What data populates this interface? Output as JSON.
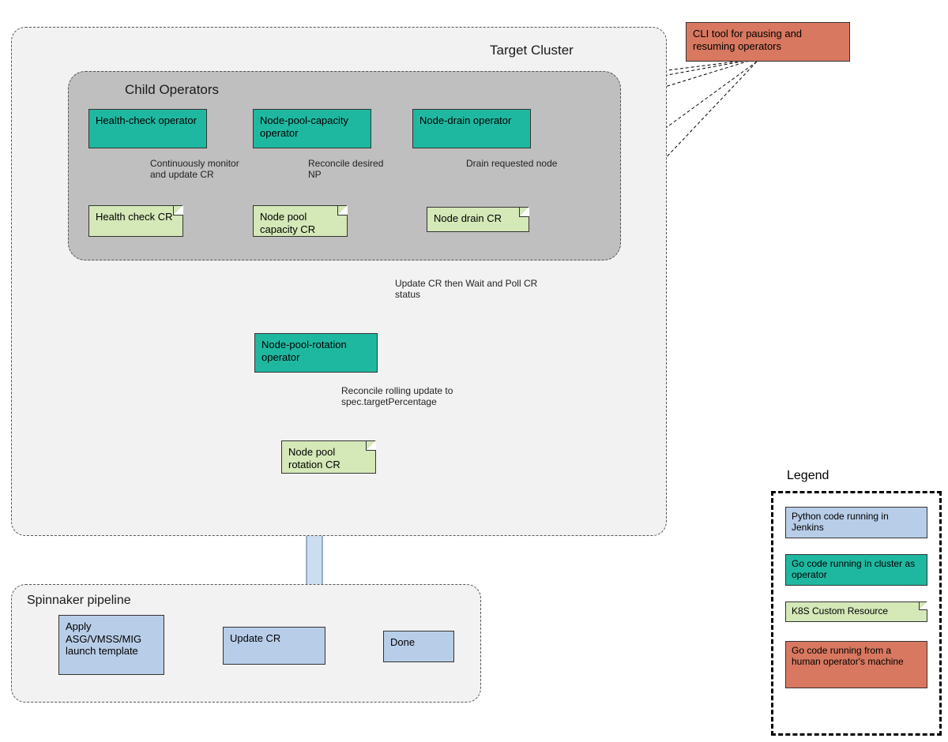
{
  "targetCluster": {
    "title": "Target Cluster",
    "childOperators": {
      "title": "Child Operators",
      "healthCheckOp": "Health-check operator",
      "nodePoolCapOp": "Node-pool-capacity operator",
      "nodeDrainOp": "Node-drain operator",
      "healthCheckCR": "Health check CR",
      "nodePoolCapCR": "Node pool capacity CR",
      "nodeDrainCR": "Node drain CR",
      "labelMonitor": "Continuously monitor and update CR",
      "labelReconcileNP": "Reconcile desired NP",
      "labelDrainNode": "Drain requested node"
    },
    "rotationOp": "Node-pool-rotation operator",
    "rotationCR": "Node pool rotation CR",
    "labelUpdatePoll": "Update CR then Wait and Poll CR status",
    "labelReconcileRolling": "Reconcile rolling update to spec.targetPercentage"
  },
  "spinnaker": {
    "title": "Spinnaker pipeline",
    "step1": "Apply ASG/VMSS/MIG launch template",
    "step2": "Update CR",
    "step3": "Done"
  },
  "cliTool": "CLI tool for pausing and resuming operators",
  "legend": {
    "title": "Legend",
    "python": "Python code running in Jenkins",
    "go": "Go code running in cluster as operator",
    "cr": "K8S Custom Resource",
    "goHuman": "Go code running from a human operator's machine"
  }
}
